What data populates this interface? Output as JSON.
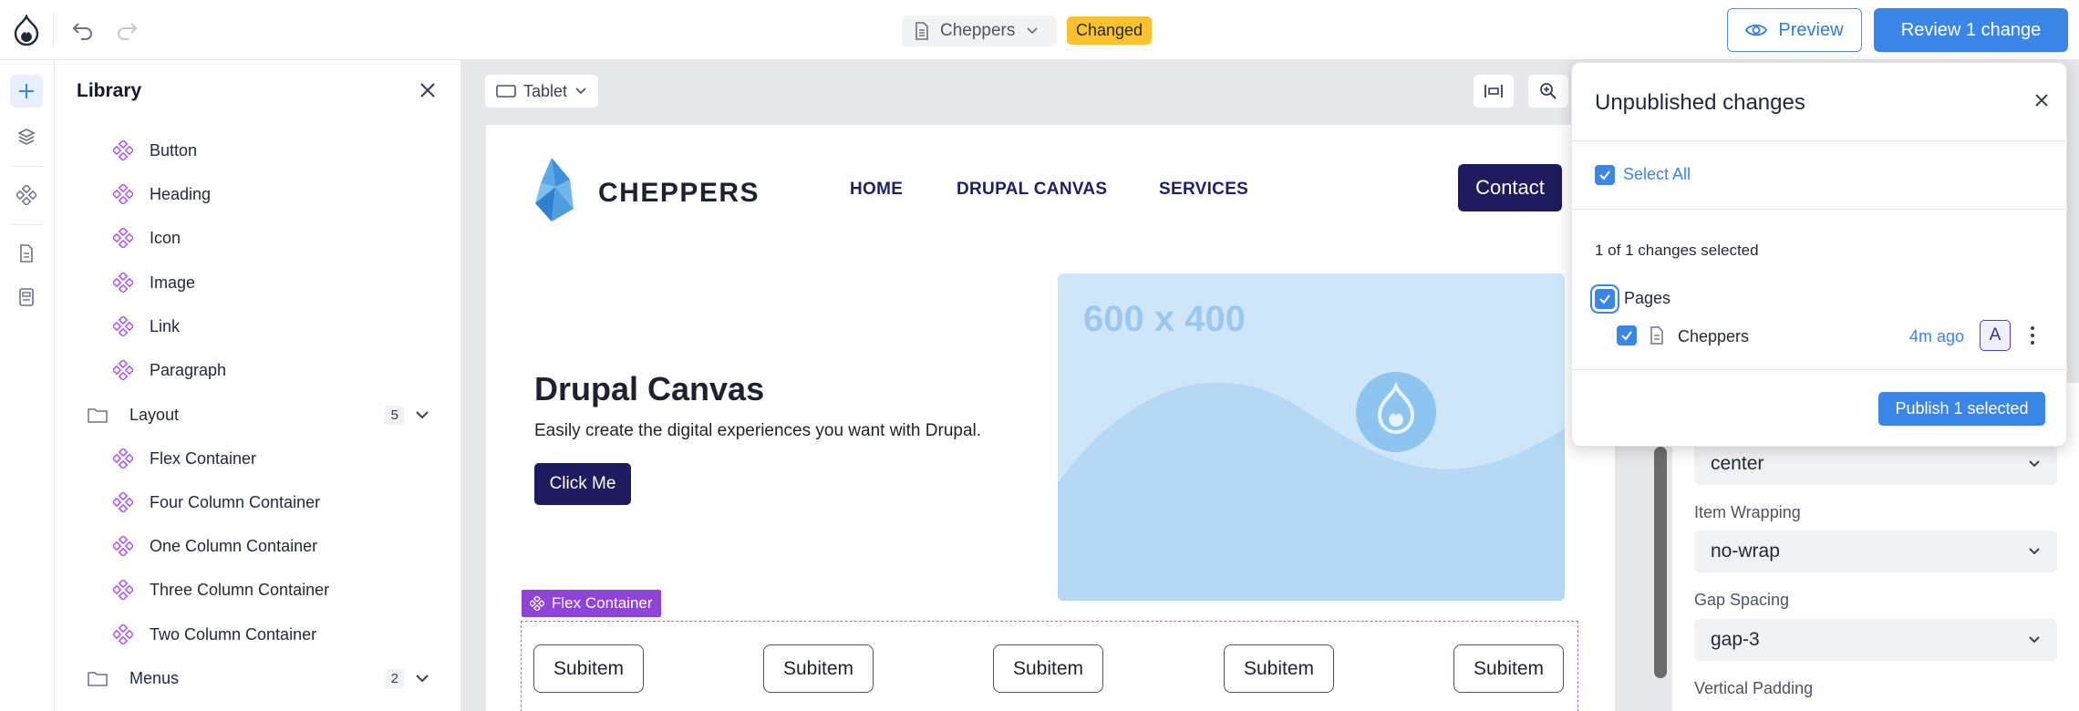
{
  "topbar": {
    "document_name": "Cheppers",
    "status_badge": "Changed",
    "preview_label": "Preview",
    "review_label": "Review 1 change"
  },
  "library": {
    "title": "Library",
    "items_top": [
      "Button",
      "Heading",
      "Icon",
      "Image",
      "Link",
      "Paragraph"
    ],
    "layout_group": {
      "label": "Layout",
      "count": "5"
    },
    "layout_items": [
      "Flex Container",
      "Four Column Container",
      "One Column Container",
      "Three Column Container",
      "Two Column Container"
    ],
    "menus_group": {
      "label": "Menus",
      "count": "2"
    }
  },
  "canvas": {
    "viewport_label": "Tablet",
    "site": {
      "logo_text": "CHEPPERS",
      "nav": [
        "HOME",
        "DRUPAL CANVAS",
        "SERVICES"
      ],
      "contact_label": "Contact",
      "hero_title": "Drupal Canvas",
      "hero_subtitle": "Easily create the digital experiences you want with Drupal.",
      "hero_button": "Click Me",
      "placeholder_text": "600 x 400",
      "flex_label": "Flex Container",
      "subitems": [
        "Subitem",
        "Subitem",
        "Subitem",
        "Subitem",
        "Subitem"
      ]
    }
  },
  "props": {
    "justify_value": "center",
    "item_wrapping_label": "Item Wrapping",
    "item_wrapping_value": "no-wrap",
    "gap_label": "Gap Spacing",
    "gap_value": "gap-3",
    "vertical_padding_label": "Vertical Padding"
  },
  "popover": {
    "title": "Unpublished changes",
    "select_all": "Select All",
    "selected_count": "1 of 1 changes selected",
    "group_label": "Pages",
    "page_name": "Cheppers",
    "time_ago": "4m ago",
    "avatar_initial": "A",
    "publish_label": "Publish 1 selected"
  },
  "colors": {
    "accent": "#3a86e8",
    "badge": "#fcc22e",
    "site_navy": "#1e1b5e",
    "component_purple": "#8e44d6"
  }
}
